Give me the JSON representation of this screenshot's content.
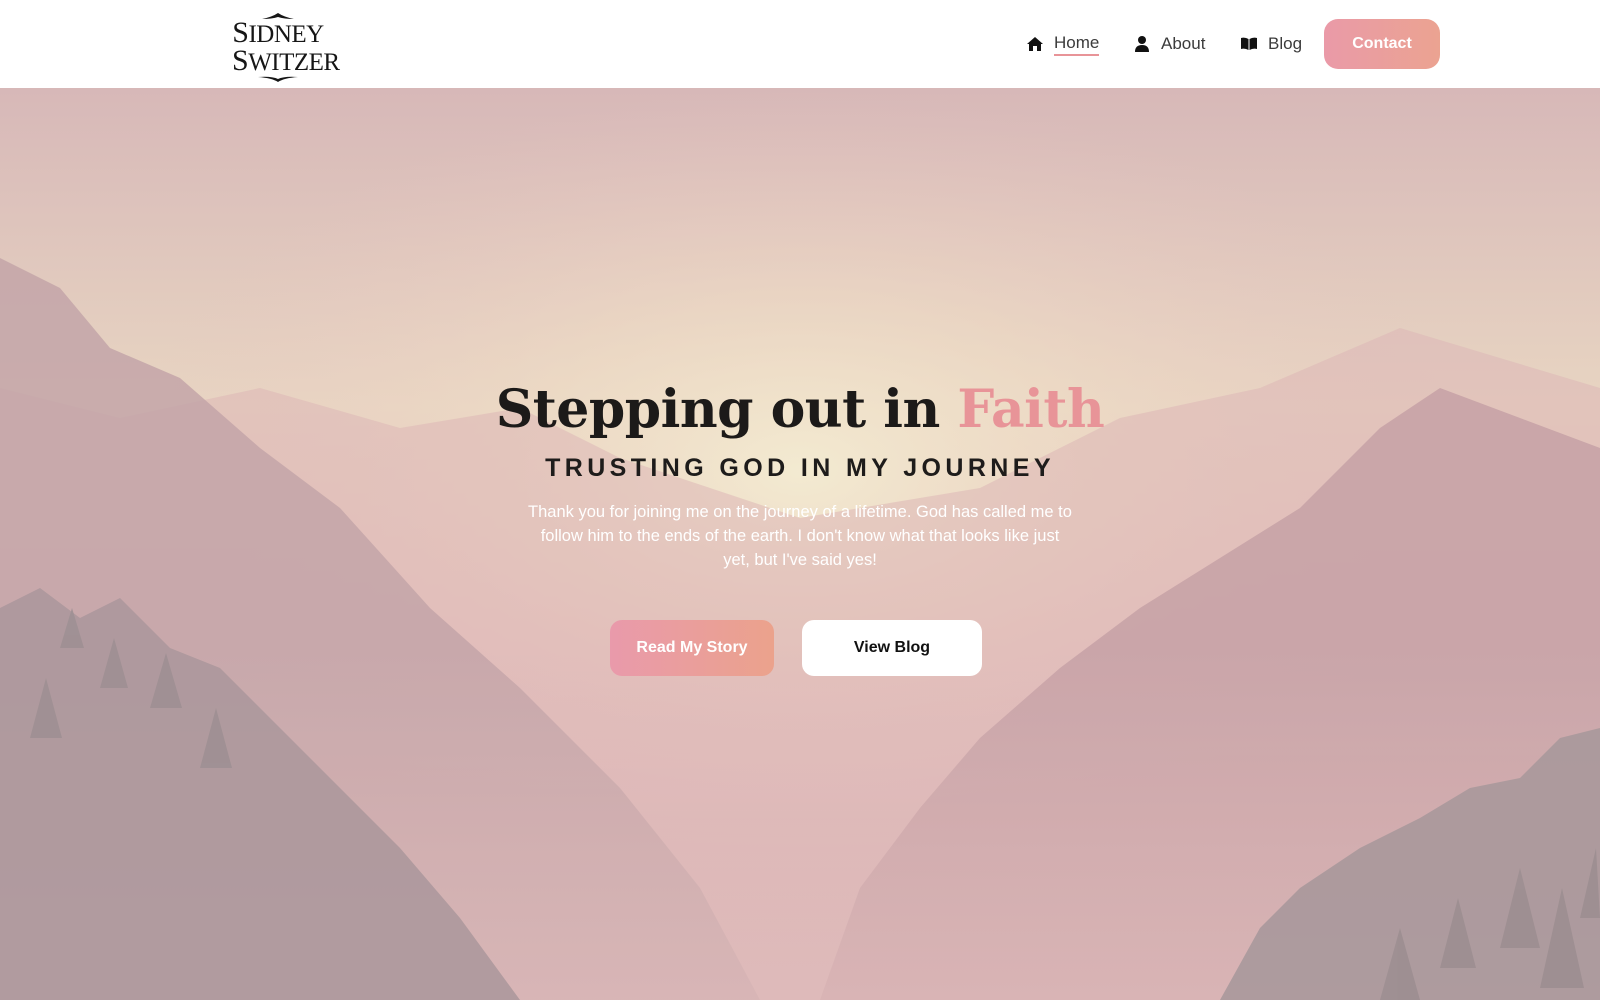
{
  "header": {
    "logo": {
      "line1_initial": "S",
      "line1_rest": "IDNEY",
      "line2_initial": "S",
      "line2_rest": "WITZER"
    },
    "nav": [
      {
        "label": "Home",
        "icon": "home-icon",
        "active": true
      },
      {
        "label": "About",
        "icon": "user-icon",
        "active": false
      },
      {
        "label": "Blog",
        "icon": "book-icon",
        "active": false
      }
    ],
    "contact_label": "Contact"
  },
  "hero": {
    "title_main": "Stepping out in ",
    "title_accent": "Faith",
    "subtitle": "TRUSTING GOD IN MY JOURNEY",
    "text": "Thank you for joining me on the journey of a lifetime. God has called me to follow him to the ends of the earth. I don't know what that looks like just yet, but I've said yes!",
    "primary_button": "Read My Story",
    "secondary_button": "View Blog"
  },
  "colors": {
    "accent": "#e89498",
    "button_gradient_start": "#ea9aa8",
    "button_gradient_end": "#eba391",
    "text_dark": "#1c1a19"
  }
}
